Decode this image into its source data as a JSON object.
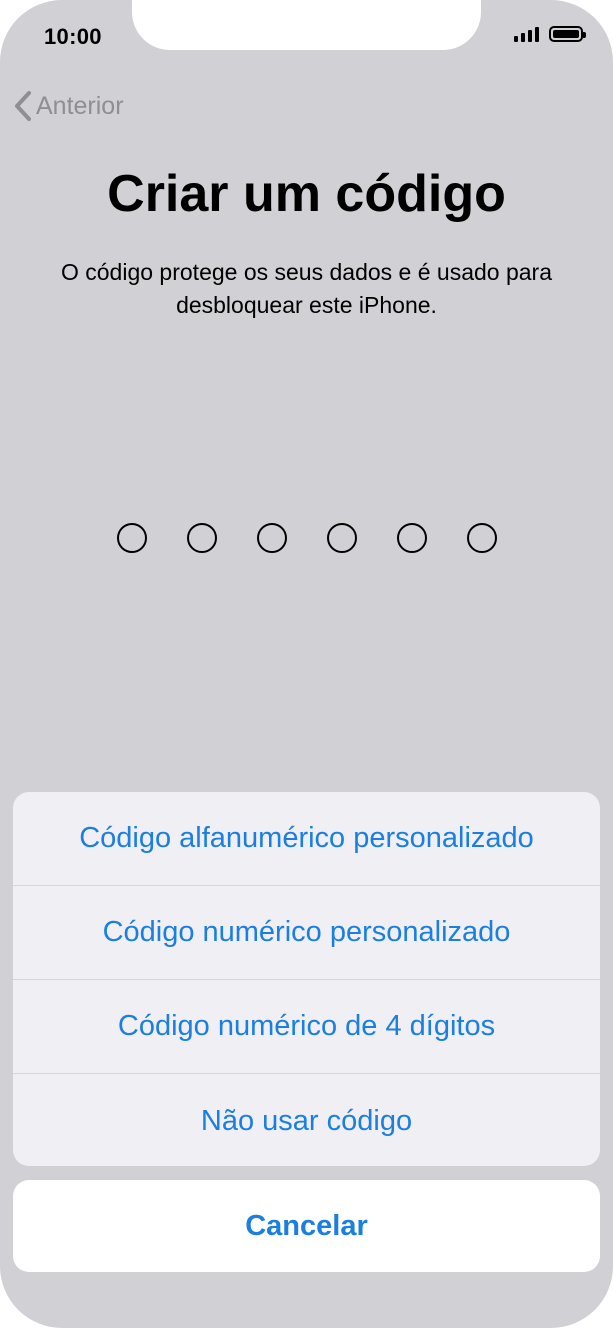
{
  "status_bar": {
    "time": "10:00",
    "signal_icon": "signal-bars-icon",
    "battery_icon": "battery-full-icon"
  },
  "nav": {
    "back_label": "Anterior",
    "back_icon": "chevron-left-icon"
  },
  "header": {
    "title": "Criar um código",
    "subtitle": "O código protege os seus dados e é usado para desbloquear este iPhone."
  },
  "passcode": {
    "digit_count": 6,
    "filled": 0
  },
  "action_sheet": {
    "options": [
      {
        "label": "Código alfanumérico personalizado"
      },
      {
        "label": "Código numérico personalizado"
      },
      {
        "label": "Código numérico de 4 dígitos"
      },
      {
        "label": "Não usar código"
      }
    ],
    "cancel_label": "Cancelar"
  },
  "colors": {
    "background": "#d1d0d5",
    "accent": "#1a7fe0",
    "back_text": "#8e8e93",
    "sheet": "#f0eff4"
  }
}
